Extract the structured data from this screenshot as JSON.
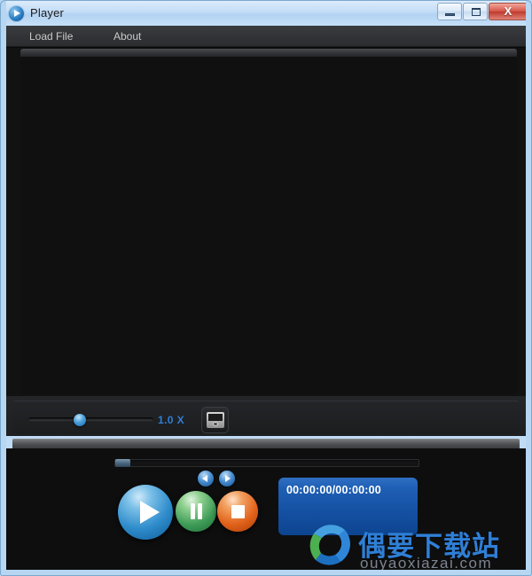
{
  "window": {
    "title": "Player",
    "icon": "play-circle-icon",
    "controls": {
      "minimize_label": "",
      "maximize_label": "",
      "close_label": "X"
    }
  },
  "menubar": {
    "items": [
      {
        "label": "Load File",
        "name": "menu-item-load-file"
      },
      {
        "label": "About",
        "name": "menu-item-about"
      }
    ]
  },
  "video": {
    "placeholder": "",
    "background_color": "#121212"
  },
  "speed_bar": {
    "slider_value": "1.0",
    "speed_label": "1.0 X",
    "knob_position_pct": 38,
    "snapshot_icon": "camera-icon"
  },
  "transport": {
    "progress_value_pct": 0,
    "prev_icon": "arrow-left-icon",
    "next_icon": "arrow-right-icon",
    "play_icon": "play-icon",
    "pause_icon": "pause-icon",
    "stop_icon": "stop-icon",
    "time_display": "00:00:00/00:00:00"
  },
  "watermark": {
    "chinese": "偶要下载站",
    "domain": "ouyaoxiazai.com"
  },
  "colors": {
    "accent_blue": "#2f7fd6",
    "play_blue": "#2f8ccb",
    "pause_green": "#3d9b56",
    "stop_orange": "#e2621a",
    "titlebar_blue": "#bcd9f4",
    "panel_dark": "#1d1f21"
  }
}
